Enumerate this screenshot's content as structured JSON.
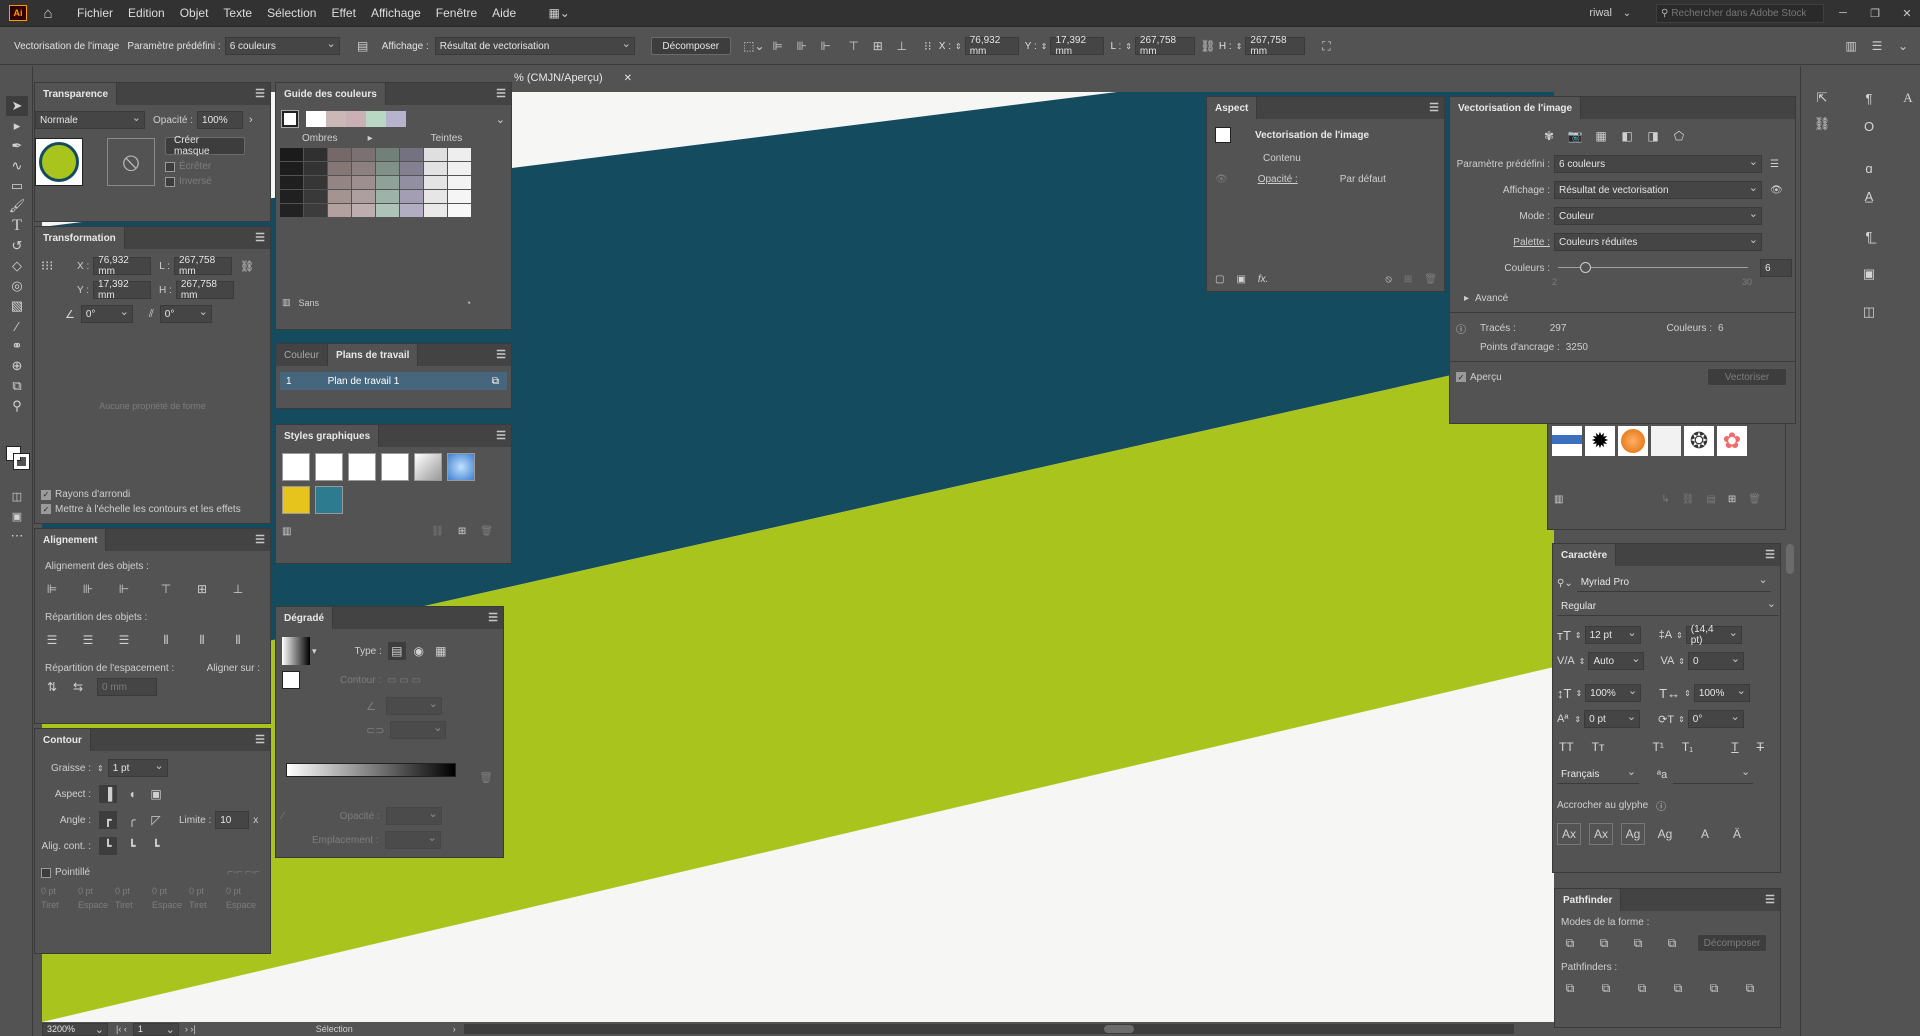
{
  "app": {
    "logo": "Ai",
    "menus": [
      "Fichier",
      "Edition",
      "Objet",
      "Texte",
      "Sélection",
      "Effet",
      "Affichage",
      "Fenêtre",
      "Aide"
    ],
    "user": "riwal",
    "search_placeholder": "Rechercher dans Adobe Stock"
  },
  "control_bar": {
    "label": "Vectorisation de l'image",
    "preset_label": "Paramètre prédéfini :",
    "preset_value": "6 couleurs",
    "view_label": "Affichage :",
    "view_value": "Résultat de vectorisation",
    "expand_button": "Décomposer",
    "x_label": "X :",
    "x_value": "76,932 mm",
    "y_label": "Y :",
    "y_value": "17,392 mm",
    "w_label": "L :",
    "w_value": "267,758 mm",
    "h_label": "H :",
    "h_value": "267,758 mm"
  },
  "document_tab": "% (CMJN/Aperçu)",
  "transparency": {
    "title": "Transparence",
    "mode": "Normale",
    "opacity_label": "Opacité :",
    "opacity_value": "100%",
    "mask_button": "Créer masque",
    "clip_label": "Écrêter",
    "invert_label": "Inversé"
  },
  "transform": {
    "title": "Transformation",
    "x_label": "X :",
    "x_value": "76,932 mm",
    "y_label": "Y :",
    "y_value": "17,392 mm",
    "w_label": "L :",
    "w_value": "267,758 mm",
    "h_label": "H :",
    "h_value": "267,758 mm",
    "angle_value": "0°",
    "shear_value": "0°",
    "no_shape": "Aucune propriété de forme",
    "rounded_label": "Rayons d'arrondi",
    "scale_label": "Mettre à l'échelle les contours et les effets"
  },
  "align": {
    "title": "Alignement",
    "align_objects": "Alignement des objets :",
    "distribute_objects": "Répartition des objets :",
    "distribute_spacing": "Répartition de l'espacement :",
    "align_to": "Aligner sur :",
    "spacing_value": "0 mm"
  },
  "stroke": {
    "title": "Contour",
    "weight_label": "Graisse :",
    "weight_value": "1 pt",
    "cap_label": "Aspect :",
    "corner_label": "Angle :",
    "limit_label": "Limite :",
    "limit_value": "10",
    "align_label": "Alig. cont. :",
    "dashed_label": "Pointillé",
    "dash_values": [
      "0 pt",
      "0 pt",
      "0 pt",
      "0 pt",
      "0 pt",
      "0 pt"
    ],
    "dash_labels": [
      "Tiret",
      "Espace",
      "Tiret",
      "Espace",
      "Tiret",
      "Espace"
    ]
  },
  "color_guide": {
    "title": "Guide des couleurs",
    "shades_label": "Ombres",
    "tints_label": "Teintes",
    "footer_label": "Sans",
    "harmony_colors": [
      "#ffffff",
      "#c9b8b6",
      "#c9b0b4",
      "#b8d8c4",
      "#b6b4cc"
    ]
  },
  "artboards": {
    "tab_color": "Couleur",
    "tab_artboards": "Plans de travail",
    "item_number": "1",
    "item_name": "Plan de travail 1"
  },
  "graphic_styles": {
    "title": "Styles graphiques"
  },
  "gradient": {
    "title": "Dégradé",
    "type_label": "Type :",
    "stroke_label": "Contour :",
    "opacity_label": "Opacité :",
    "location_label": "Emplacement :"
  },
  "appearance": {
    "title": "Aspect",
    "object_name": "Vectorisation de l'image",
    "content_label": "Contenu",
    "opacity_label": "Opacité :",
    "opacity_value": "Par défaut"
  },
  "image_trace": {
    "title": "Vectorisation de l'image",
    "preset_label": "Paramètre prédéfini :",
    "preset_value": "6 couleurs",
    "view_label": "Affichage :",
    "view_value": "Résultat de vectorisation",
    "mode_label": "Mode :",
    "mode_value": "Couleur",
    "palette_label": "Palette :",
    "palette_value": "Couleurs réduites",
    "colors_label": "Couleurs :",
    "colors_value": "6",
    "colors_fraction": 0.14,
    "slider_min": "2",
    "slider_max": "30",
    "advanced_label": "Avancé",
    "paths_label": "Tracés :",
    "paths_value": "297",
    "colors_count_label": "Couleurs :",
    "colors_count_value": "6",
    "anchors_label": "Points d'ancrage :",
    "anchors_value": "3250",
    "preview_label": "Aperçu",
    "trace_button": "Vectoriser"
  },
  "character": {
    "title": "Caractère",
    "font_family": "Myriad Pro",
    "font_style": "Regular",
    "size_value": "12 pt",
    "leading_value": "(14,4 pt)",
    "kerning_value": "Auto",
    "tracking_value": "0",
    "vscale_value": "100%",
    "hscale_value": "100%",
    "baseline_value": "0 pt",
    "rotation_value": "0°",
    "language_value": "Français",
    "snap_label": "Accrocher au glyphe"
  },
  "pathfinder": {
    "title": "Pathfinder",
    "shape_modes_label": "Modes de la forme :",
    "expand_button": "Décomposer",
    "pathfinders_label": "Pathfinders :"
  },
  "status_bar": {
    "zoom": "3200%",
    "artboard": "1",
    "tool": "Sélection"
  },
  "colors": {
    "artwork_blue": "#154b5f",
    "artwork_green": "#a9c51d",
    "artwork_white": "#f6f6f4",
    "ui_bg": "#535353"
  }
}
